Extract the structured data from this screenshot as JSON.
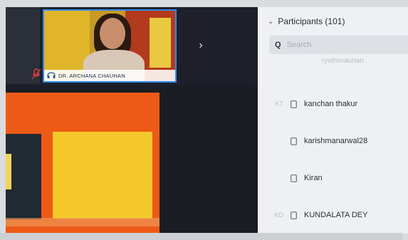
{
  "meeting": {
    "video_tile": {
      "name_label": "DR. ARCHANA CHAUHAN"
    },
    "next_arrow": "›"
  },
  "participants_panel": {
    "title": "Participants (101)",
    "search_placeholder": "Search",
    "clipped_row_text": "ryotrenaunan",
    "participants": [
      {
        "initials": "KT",
        "name": "kanchan thakur"
      },
      {
        "initials": "",
        "name": "karishmanarwal28"
      },
      {
        "initials": "",
        "name": "Kiran"
      },
      {
        "initials": "KD",
        "name": "KUNDALATA DEY"
      }
    ]
  },
  "colors": {
    "active_speaker_border": "#2e8cf0",
    "panel_bg": "#eef0f3",
    "slide_orange": "#ec5a16",
    "slide_yellow": "#f4c82a"
  }
}
